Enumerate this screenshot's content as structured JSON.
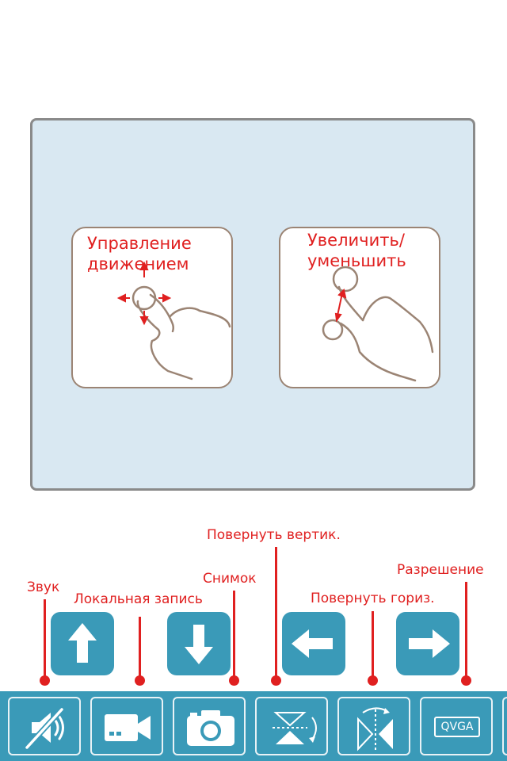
{
  "help": {
    "move_card": {
      "title": "Управление\nдвижением"
    },
    "zoom_card": {
      "title": "Увеличить/\nуменьшить"
    }
  },
  "callouts": {
    "sound": "Звук",
    "local_record": "Локальная запись",
    "snapshot": "Снимок",
    "flip_vertical": "Повернуть вертик.",
    "flip_horizontal": "Повернуть гориз.",
    "resolution": "Разрешение"
  },
  "toolbar": {
    "resolution_label": "QVGA"
  },
  "colors": {
    "accent": "#3a9ab8",
    "callout": "#e02020",
    "panel": "#d9e8f2"
  },
  "icons": [
    "mute-icon",
    "video-camera-icon",
    "camera-icon",
    "flip-vertical-icon",
    "flip-horizontal-icon",
    "arrow-up-icon",
    "arrow-down-icon",
    "arrow-left-icon",
    "arrow-right-icon"
  ]
}
